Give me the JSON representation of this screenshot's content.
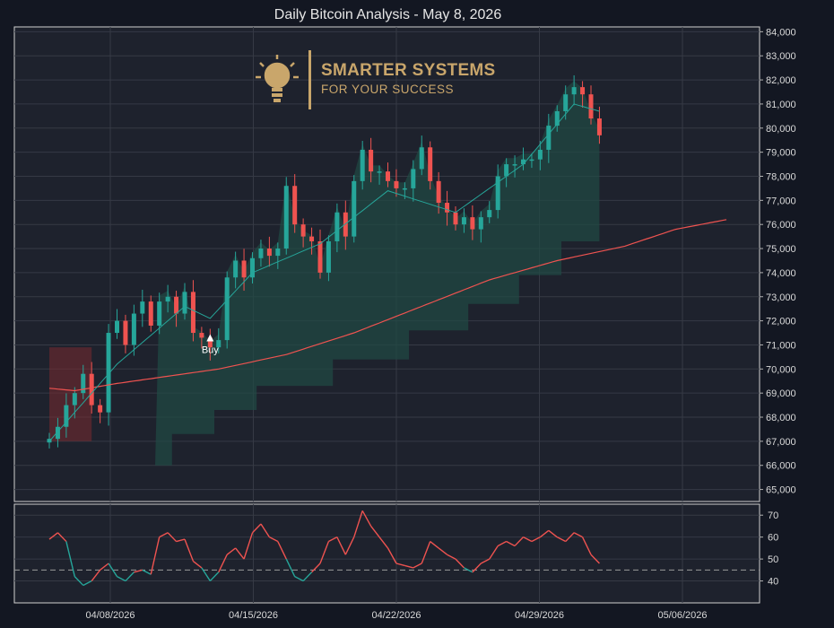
{
  "title": "Daily Bitcoin Analysis - May 8, 2026",
  "logo": {
    "line1": "SMARTER SYSTEMS",
    "line2": "FOR YOUR SUCCESS",
    "icon": "lightbulb-icon",
    "color": "#c9a66b"
  },
  "colors": {
    "background": "#1e222d",
    "up": "#26a69a",
    "down": "#ef5350",
    "fast_ma": "#26a69a",
    "slow_ma": "#ef5350",
    "rsi_up": "#26a69a",
    "rsi_down": "#ef5350",
    "band": "#1f4a45",
    "zone": "#7a2a30"
  },
  "chart_data": {
    "type": "candlestick",
    "title": "Daily Bitcoin Analysis - May 8, 2026",
    "x_ticks": [
      "04/08/2026",
      "04/15/2026",
      "04/22/2026",
      "04/29/2026",
      "05/06/2026"
    ],
    "price_axis": {
      "ylim": [
        64500,
        84200
      ],
      "ticks": [
        65000,
        66000,
        67000,
        68000,
        69000,
        70000,
        71000,
        72000,
        73000,
        74000,
        75000,
        76000,
        77000,
        78000,
        79000,
        80000,
        81000,
        82000,
        83000,
        84000
      ]
    },
    "close_series": [
      [
        0,
        67100
      ],
      [
        1,
        67600
      ],
      [
        2,
        68500
      ],
      [
        3,
        69000
      ],
      [
        4,
        69800
      ],
      [
        5,
        68500
      ],
      [
        6,
        68200
      ],
      [
        7,
        71500
      ],
      [
        8,
        72000
      ],
      [
        9,
        71000
      ],
      [
        10,
        72300
      ],
      [
        11,
        72800
      ],
      [
        12,
        71800
      ],
      [
        13,
        72800
      ],
      [
        14,
        73000
      ],
      [
        15,
        72300
      ],
      [
        16,
        73200
      ],
      [
        17,
        71500
      ],
      [
        18,
        71300
      ],
      [
        19,
        70900
      ],
      [
        20,
        71200
      ],
      [
        21,
        73800
      ],
      [
        22,
        74500
      ],
      [
        23,
        73800
      ],
      [
        24,
        74600
      ],
      [
        25,
        75000
      ],
      [
        26,
        74700
      ],
      [
        27,
        75000
      ],
      [
        28,
        77600
      ],
      [
        29,
        76000
      ],
      [
        30,
        75500
      ],
      [
        31,
        75300
      ],
      [
        32,
        74000
      ],
      [
        33,
        75300
      ],
      [
        34,
        76500
      ],
      [
        35,
        75500
      ],
      [
        36,
        77800
      ],
      [
        37,
        79100
      ],
      [
        38,
        78200
      ],
      [
        39,
        78200
      ],
      [
        40,
        77800
      ],
      [
        41,
        77500
      ],
      [
        42,
        77500
      ],
      [
        43,
        78300
      ],
      [
        44,
        79200
      ],
      [
        45,
        77800
      ],
      [
        46,
        76900
      ],
      [
        47,
        76500
      ],
      [
        48,
        76000
      ],
      [
        49,
        76300
      ],
      [
        50,
        75800
      ],
      [
        51,
        76300
      ],
      [
        52,
        76600
      ],
      [
        53,
        78000
      ],
      [
        54,
        78500
      ],
      [
        55,
        78500
      ],
      [
        56,
        78700
      ],
      [
        57,
        78700
      ],
      [
        58,
        79100
      ],
      [
        59,
        80100
      ],
      [
        60,
        80700
      ],
      [
        61,
        81400
      ],
      [
        62,
        81700
      ],
      [
        63,
        81400
      ],
      [
        64,
        80400
      ],
      [
        65,
        79700
      ]
    ],
    "fast_ma": [
      [
        0,
        67000
      ],
      [
        8,
        70200
      ],
      [
        16,
        72600
      ],
      [
        19,
        72100
      ],
      [
        24,
        74000
      ],
      [
        32,
        75200
      ],
      [
        40,
        77400
      ],
      [
        48,
        76500
      ],
      [
        56,
        78500
      ],
      [
        62,
        81000
      ],
      [
        65,
        80700
      ]
    ],
    "slow_ma": [
      [
        0,
        69200
      ],
      [
        3,
        69100
      ],
      [
        8,
        69400
      ],
      [
        14,
        69700
      ],
      [
        20,
        70000
      ],
      [
        28,
        70600
      ],
      [
        36,
        71500
      ],
      [
        44,
        72600
      ],
      [
        52,
        73700
      ],
      [
        60,
        74500
      ],
      [
        68,
        75100
      ],
      [
        74,
        75800
      ],
      [
        80,
        76200
      ]
    ],
    "band_bottom_steps": [
      [
        13,
        66000
      ],
      [
        15,
        67300
      ],
      [
        20,
        68300
      ],
      [
        25,
        69300
      ],
      [
        34,
        70400
      ],
      [
        43,
        71600
      ],
      [
        50,
        72700
      ],
      [
        56,
        73900
      ],
      [
        61,
        75300
      ],
      [
        66,
        76200
      ]
    ],
    "zone": {
      "x0": 0,
      "x1": 5,
      "y0": 67000,
      "y1": 70900
    },
    "signals": [
      {
        "label": "Buy",
        "x": 19,
        "price": 71000
      }
    ],
    "rsi": {
      "ylim": [
        30,
        75
      ],
      "ticks": [
        40,
        50,
        60,
        70
      ],
      "threshold": 45,
      "values": [
        [
          0,
          59
        ],
        [
          1,
          62
        ],
        [
          2,
          58
        ],
        [
          3,
          42
        ],
        [
          4,
          38
        ],
        [
          5,
          40
        ],
        [
          6,
          45
        ],
        [
          7,
          48
        ],
        [
          8,
          42
        ],
        [
          9,
          40
        ],
        [
          10,
          44
        ],
        [
          11,
          45
        ],
        [
          12,
          43
        ],
        [
          13,
          60
        ],
        [
          14,
          62
        ],
        [
          15,
          58
        ],
        [
          16,
          59
        ],
        [
          17,
          49
        ],
        [
          18,
          46
        ],
        [
          19,
          40
        ],
        [
          20,
          44
        ],
        [
          21,
          52
        ],
        [
          22,
          55
        ],
        [
          23,
          50
        ],
        [
          24,
          62
        ],
        [
          25,
          66
        ],
        [
          26,
          60
        ],
        [
          27,
          58
        ],
        [
          28,
          50
        ],
        [
          29,
          42
        ],
        [
          30,
          40
        ],
        [
          31,
          44
        ],
        [
          32,
          48
        ],
        [
          33,
          58
        ],
        [
          34,
          60
        ],
        [
          35,
          52
        ],
        [
          36,
          60
        ],
        [
          37,
          72
        ],
        [
          38,
          65
        ],
        [
          39,
          60
        ],
        [
          40,
          55
        ],
        [
          41,
          48
        ],
        [
          42,
          47
        ],
        [
          43,
          46
        ],
        [
          44,
          48
        ],
        [
          45,
          58
        ],
        [
          46,
          55
        ],
        [
          47,
          52
        ],
        [
          48,
          50
        ],
        [
          49,
          46
        ],
        [
          50,
          44
        ],
        [
          51,
          48
        ],
        [
          52,
          50
        ],
        [
          53,
          56
        ],
        [
          54,
          58
        ],
        [
          55,
          56
        ],
        [
          56,
          60
        ],
        [
          57,
          58
        ],
        [
          58,
          60
        ],
        [
          59,
          63
        ],
        [
          60,
          60
        ],
        [
          61,
          58
        ],
        [
          62,
          62
        ],
        [
          63,
          60
        ],
        [
          64,
          52
        ],
        [
          65,
          48
        ]
      ]
    }
  }
}
